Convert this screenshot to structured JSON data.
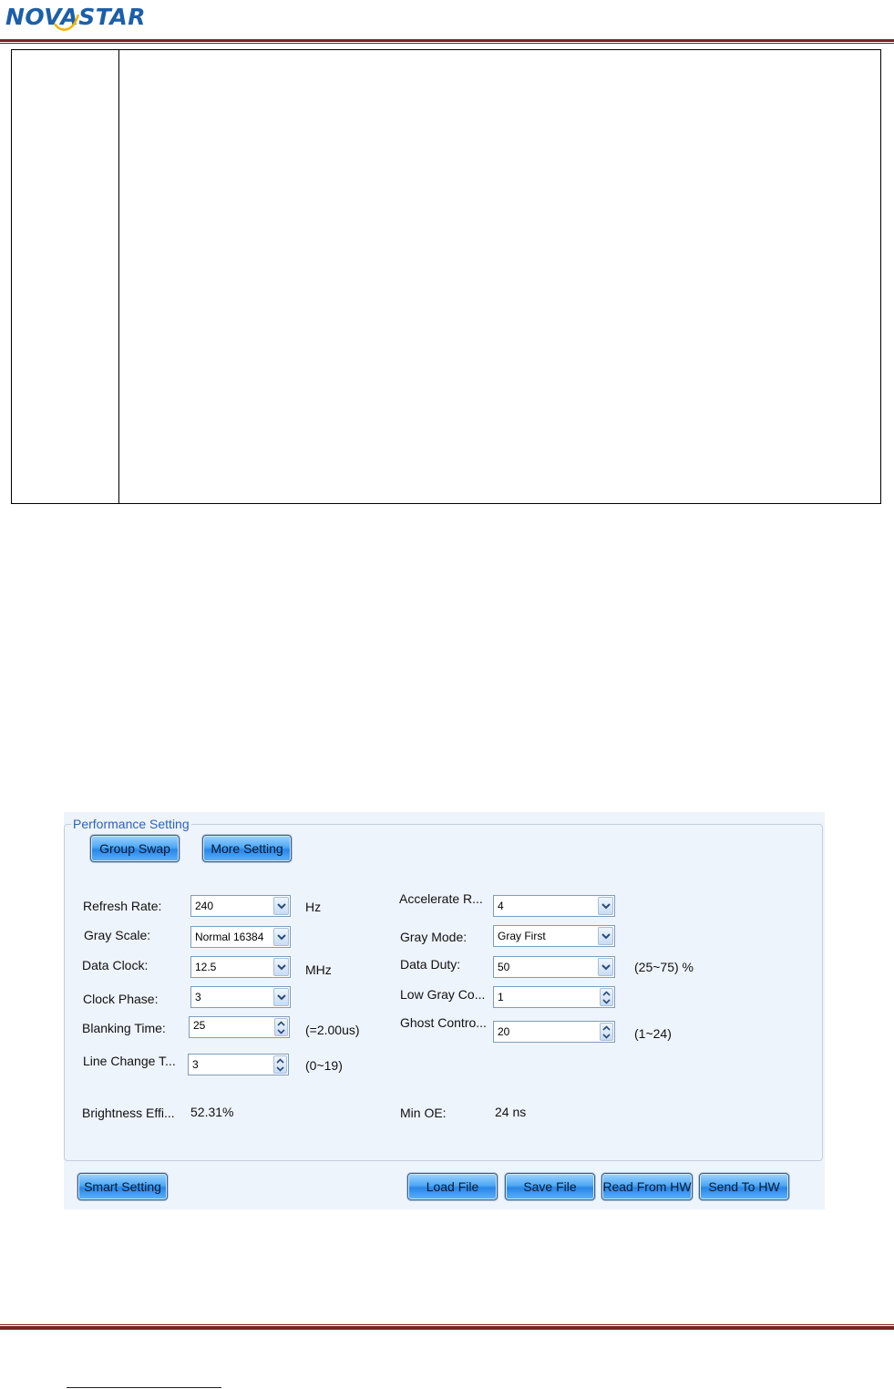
{
  "header": {
    "logo_left": "NOVA",
    "logo_right": "STAR"
  },
  "panel": {
    "title": "Performance Setting",
    "top_buttons": {
      "group_swap": "Group Swap",
      "more_setting": "More Setting"
    },
    "left_fields": {
      "refresh_rate": {
        "label": "Refresh Rate:",
        "value": "240",
        "unit": "Hz"
      },
      "gray_scale": {
        "label": "Gray Scale:",
        "value": "Normal 16384"
      },
      "data_clock": {
        "label": "Data Clock:",
        "value": "12.5",
        "unit": "MHz"
      },
      "clock_phase": {
        "label": "Clock Phase:",
        "value": "3"
      },
      "blanking_time": {
        "label": "Blanking Time:",
        "value": "25",
        "note": "(=2.00us)"
      },
      "line_change": {
        "label": "Line Change T...",
        "value": "3",
        "note": "(0~19)"
      },
      "brightness": {
        "label": "Brightness Effi...",
        "value": "52.31%"
      }
    },
    "right_fields": {
      "accelerate": {
        "label": "Accelerate R...",
        "value": "4"
      },
      "gray_mode": {
        "label": "Gray Mode:",
        "value": "Gray First"
      },
      "data_duty": {
        "label": "Data Duty:",
        "value": "50",
        "note": "(25~75) %"
      },
      "low_gray": {
        "label": "Low Gray Co...",
        "value": "1"
      },
      "ghost_control": {
        "label": "Ghost Contro...",
        "value": "20",
        "note": "(1~24)"
      },
      "min_oe": {
        "label": "Min OE:",
        "value": "24 ns"
      }
    },
    "bottom_buttons": {
      "smart_setting": "Smart Setting",
      "load_file": "Load File",
      "save_file": "Save File",
      "read_from_hw": "Read From HW",
      "send_to_hw": "Send To HW"
    }
  },
  "colors": {
    "rule": "#7a2222",
    "legend": "#2d63b8",
    "panel_bg": "#eef4fb",
    "button_blue": "#2a86e6"
  }
}
